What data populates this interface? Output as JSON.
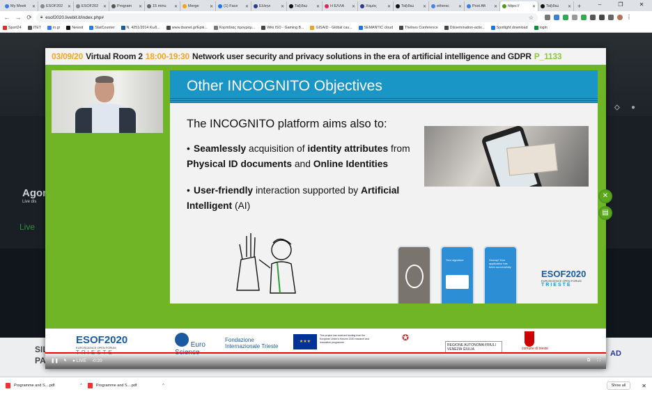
{
  "tabs": [
    {
      "label": "My Meeti",
      "color": "#3b7de0"
    },
    {
      "label": "ESOF202",
      "color": "#888888"
    },
    {
      "label": "ESOF202",
      "color": "#888888"
    },
    {
      "label": "Program",
      "color": "#555555"
    },
    {
      "label": "15 minu",
      "color": "#666666"
    },
    {
      "label": "Merge",
      "color": "#f2a21b"
    },
    {
      "label": "(1) Face",
      "color": "#1877f2"
    },
    {
      "label": "Ελληνι",
      "color": "#2a3b8f"
    },
    {
      "label": "Ταξιδιώ",
      "color": "#111111"
    },
    {
      "label": "Η ΕΛΛΑ",
      "color": "#e0245e"
    },
    {
      "label": "Χαμός",
      "color": "#2a3b8f"
    },
    {
      "label": "Ταξιδιώ",
      "color": "#111111"
    },
    {
      "label": "ethersc",
      "color": "#4285f4"
    },
    {
      "label": "Post Aft",
      "color": "#3b7de0"
    },
    {
      "label": "https://",
      "color": "#4e9a1e",
      "active": true
    },
    {
      "label": "Ταξιδιώ",
      "color": "#111111"
    }
  ],
  "url": "esof2020.livebit.it/index.php#",
  "bookmarks": [
    {
      "label": "Sport24",
      "color": "#d93025"
    },
    {
      "label": "ITET",
      "color": "#555555"
    },
    {
      "label": "in.gr",
      "color": "#3b7de0"
    },
    {
      "label": "Newsit",
      "color": "#111111"
    },
    {
      "label": "StatCounter",
      "color": "#2a7ae2"
    },
    {
      "label": "N. 4251/2014 Κωδ...",
      "color": "#1a5aa0"
    },
    {
      "label": "www.dsanet.gr/Epik...",
      "color": "#444444"
    },
    {
      "label": "Κορπάλας προγραμ...",
      "color": "#777777"
    },
    {
      "label": "Wiki ISO - Gaming B...",
      "color": "#444444"
    },
    {
      "label": "GISAID - Global cas...",
      "color": "#f2a21b"
    },
    {
      "label": "SEMANTIC cloud",
      "color": "#1a73e8"
    },
    {
      "label": "Thelnes Conference",
      "color": "#444444"
    },
    {
      "label": "Dissemination-activ...",
      "color": "#444444"
    },
    {
      "label": "Spotlight download",
      "color": "#1a73e8"
    },
    {
      "label": "login",
      "color": "#0a8f3c"
    }
  ],
  "background": {
    "left_name": "Agor",
    "left_sub": "Live dis",
    "live": "Live",
    "bottom_left": "SIL",
    "bottom_left2": "PAN",
    "bottom_right": "AD"
  },
  "modal": {
    "date": "03/09/20",
    "room": "Virtual Room 2",
    "time": "18:00-19:30",
    "topic": "Network user security and privacy solutions in the era of artificial intelligence and GDPR",
    "code": "P_1133"
  },
  "slide": {
    "title": "Other INCOGNITO Objectives",
    "intro": "The INCOGNITO platform aims also to:",
    "bullets": [
      {
        "b1": "Seamlessly",
        "t1": " acquisition of ",
        "b2": "identity attributes",
        "t2": " from ",
        "b3": "Physical ID documents",
        "t3": " and ",
        "b4": "Online Identities"
      },
      {
        "b1": "User-friendly",
        "t1": " interaction supported by ",
        "b2": "Artificial Intelligent",
        "t2": " (AI)"
      }
    ],
    "phone_texts": [
      "Your signature",
      "Hooray! Your application has been successfully"
    ],
    "logo": "ESOF2020",
    "logo_sub": "EUROSCIENCE OPEN FORUM",
    "logo_city": "TRIESTE"
  },
  "footer": {
    "esof": "ESOF2020",
    "esof_sub": "EUROSCIENCE OPEN FORUM",
    "esof_city": "TRIESTE",
    "euro": "Euro Science",
    "fit": "Fondazione Internazionale Trieste",
    "eu": "This project has received funding from the European Union's Horizon 2020 research and innovation programme",
    "fvg": "REGIONE AUTONOMA FRIULI VENEZIA GIULIA",
    "comune": "comune di trieste"
  },
  "player": {
    "live": "LIVE",
    "time": "-0:20"
  },
  "downloads": {
    "items": [
      "Programme and S....pdf",
      "Programme and S....pdf"
    ],
    "show_all": "Show all"
  }
}
